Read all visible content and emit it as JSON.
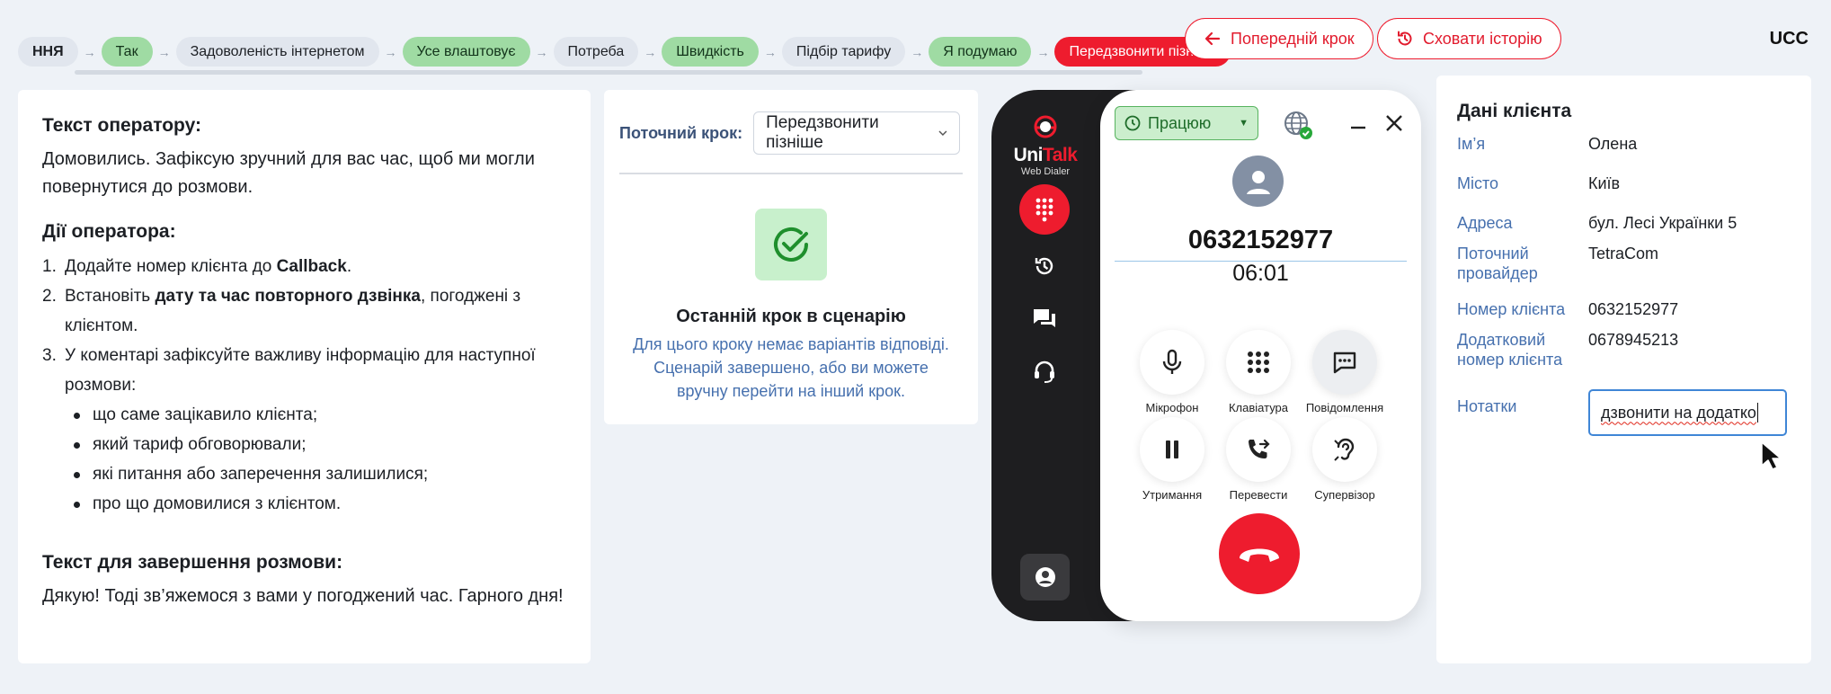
{
  "breadcrumb": [
    {
      "label": "ННЯ",
      "style": "grey",
      "bold": true
    },
    {
      "label": "Так",
      "style": "green"
    },
    {
      "label": "Задоволеність інтернетом",
      "style": "grey"
    },
    {
      "label": "Усе влаштовує",
      "style": "green"
    },
    {
      "label": "Потреба",
      "style": "grey"
    },
    {
      "label": "Швидкість",
      "style": "green"
    },
    {
      "label": "Підбір тарифу",
      "style": "grey"
    },
    {
      "label": "Я подумаю",
      "style": "green"
    },
    {
      "label": "Передзвонити пізніше",
      "style": "red"
    }
  ],
  "history": {
    "prev_label": "Попередній крок",
    "hide_label": "Сховати історію"
  },
  "brand_corner": "UCC",
  "script": {
    "operator_text_title": "Текст оператору:",
    "operator_text": "Домовились. Зафіксую зручний для вас час, щоб ми могли повернутися до розмови.",
    "actions_title": "Дії оператора:",
    "actions": [
      {
        "num": "1.",
        "parts": [
          {
            "t": "Додайте номер клієнта до "
          },
          {
            "t": "Callback",
            "b": true
          },
          {
            "t": "."
          }
        ]
      },
      {
        "num": "2.",
        "parts": [
          {
            "t": "Встановіть "
          },
          {
            "t": "дату та час повторного дзвінка",
            "b": true
          },
          {
            "t": ", погоджені з клієнтом."
          }
        ]
      },
      {
        "num": "3.",
        "parts": [
          {
            "t": "У коментарі зафіксуйте важливу інформацію для наступної розмови:"
          }
        ]
      }
    ],
    "bullets": [
      "що саме зацікавило клієнта;",
      "який тариф обговорювали;",
      "які питання або заперечення залишилися;",
      "про що домовилися з клієнтом."
    ],
    "closing_title": "Текст для завершення розмови:",
    "closing_text": "Дякую! Тоді зв’яжемося з вами у погоджений час. Гарного дня!"
  },
  "step": {
    "label": "Поточний крок:",
    "selected": "Передзвонити пізніше",
    "end_title": "Останній крок в сценарію",
    "end_text": "Для цього кроку немає варіантів відповіді. Сценарій завершено, або ви можете вручну перейти на інший крок."
  },
  "dialer": {
    "brand_uni": "Uni",
    "brand_talk": "Talk",
    "brand_sub": "Web Dialer",
    "status": "Працюю",
    "phone": "0632152977",
    "timer": "06:01",
    "controls": {
      "mic": "Мікрофон",
      "keypad": "Клавіатура",
      "messages": "Повідомлення",
      "hold": "Утримання",
      "transfer": "Перевести",
      "supervisor": "Супервізор"
    },
    "colors": {
      "accent": "#ee1c2e",
      "status_bg": "#cbeecd"
    }
  },
  "client": {
    "title": "Дані клієнта",
    "fields": [
      {
        "k": "Ім’я",
        "v": "Олена"
      },
      {
        "k": "Місто",
        "v": "Київ"
      },
      {
        "k": "Адреса",
        "v": "бул. Лесі Українки 5"
      },
      {
        "k": "Поточний провайдер",
        "v": "TetraCom"
      },
      {
        "k": "Номер клієнта",
        "v": "0632152977"
      },
      {
        "k": "Додатковий номер клієнта",
        "v": "0678945213"
      }
    ],
    "notes_label": "Нотатки",
    "notes_value": "дзвонити на додатко"
  }
}
